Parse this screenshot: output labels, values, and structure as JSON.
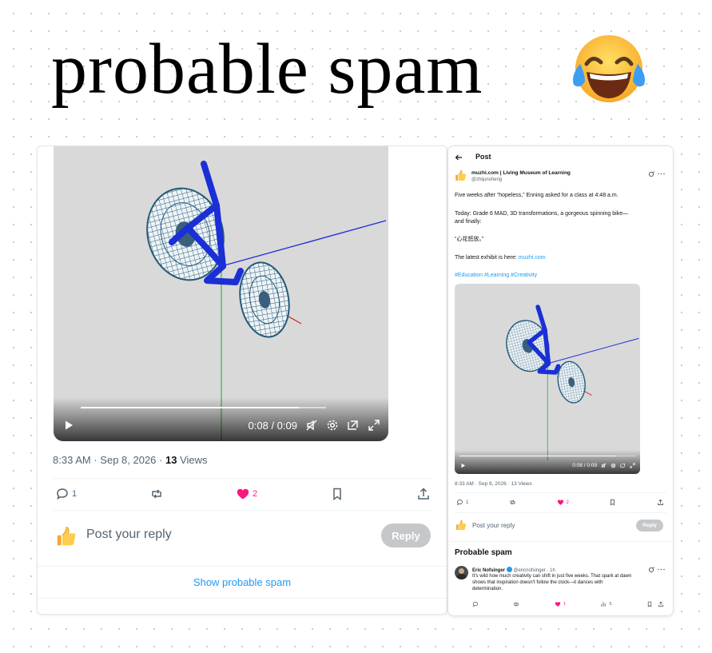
{
  "headline": {
    "text": "probable spam",
    "emoji": "face-with-tears-of-joy"
  },
  "colors": {
    "accent": "#1d9bf0",
    "like": "#f91880",
    "muted": "#536471",
    "bike": "#1a2fd6",
    "wheel": "#235a78"
  },
  "main_post": {
    "video": {
      "time": "0:08 / 0:09",
      "progress": 0.89
    },
    "meta": {
      "time": "8:33 AM",
      "date": "Sep 8, 2026",
      "sep": "·",
      "views_count": "13",
      "views_label": "Views"
    },
    "actions": {
      "replies": "1",
      "likes": "2"
    },
    "reply": {
      "placeholder": "Post your reply",
      "button": "Reply"
    },
    "show_spam": "Show probable spam"
  },
  "thread": {
    "header": "Post",
    "author": {
      "name": "muzhi.com | Living Museum of Learning",
      "handle": "@zhijunsheng"
    },
    "body": {
      "p1": "Five weeks after “hopeless,” Enning asked for a class at 4:48 a.m.",
      "p2a": "Today: Grade 6 MAD, 3D transformations, a gorgeous spinning bike—",
      "p2b": "and finally:",
      "p3": "“心花怒放。”",
      "p4": "The latest exhibit is here:",
      "link": "muzhi.com",
      "hashtags": "#Education #Learning #Creativity"
    },
    "video": {
      "time": "0:08 / 0:09",
      "progress": 0.89
    },
    "meta": "8:33 AM · Sep 8, 2026 · 13 Views",
    "actions": {
      "replies": "1",
      "likes": "2"
    },
    "reply": {
      "placeholder": "Post your reply",
      "button": "Reply"
    },
    "spam_section": {
      "heading": "Probable spam",
      "reply": {
        "name": "Eric Nofsinger",
        "handle_time": "@ericnofsinger · 1h",
        "line1": "It’s wild how much creativity can shift in just five weeks. That spark at dawn",
        "line2": "shows that inspiration doesn’t follow the clock—it dances with",
        "line3": "determination.",
        "likes": "1",
        "views": "5"
      }
    }
  }
}
